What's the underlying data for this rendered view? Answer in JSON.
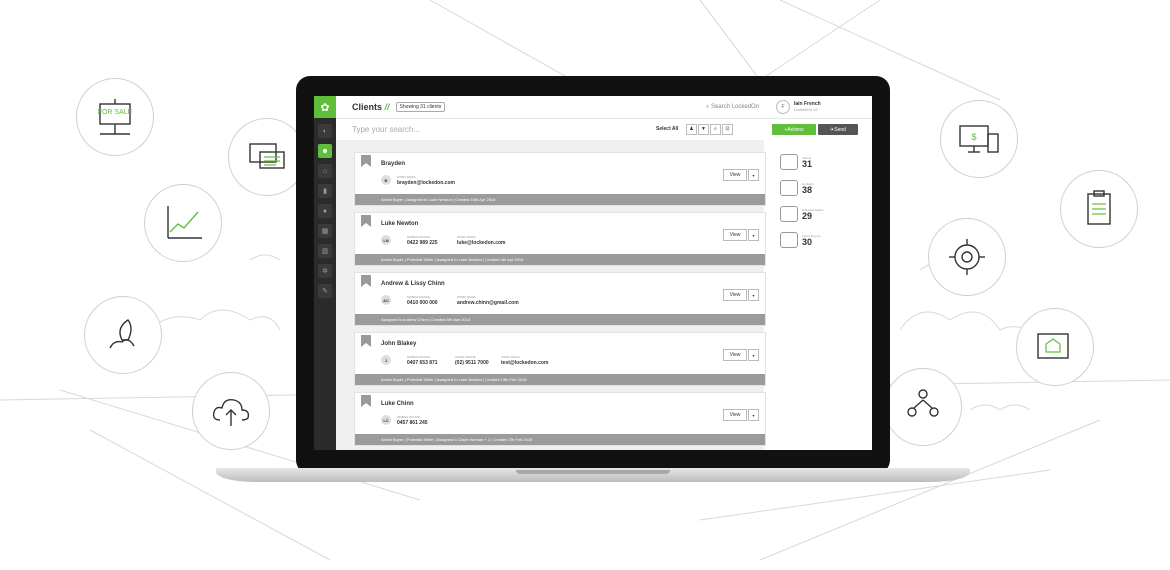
{
  "app": {
    "title": "Clients",
    "title_suffix": "//",
    "count_badge": "Showing 31 clients",
    "search_label": "Search LockedOn",
    "user_initial": "F",
    "user_name": "Iain French",
    "user_company": "LockedOn v2"
  },
  "filter": {
    "placeholder": "Type your search...",
    "select_all": "Select All",
    "actions_label": "Actions",
    "send_label": "Send"
  },
  "labels": {
    "mobile_phone": "MOBILE PHONE",
    "work_email": "WORK EMAIL",
    "home_phone": "HOME PHONE",
    "view": "View"
  },
  "clients": [
    {
      "name": "Brayden",
      "initials": "B",
      "phone": "",
      "home_phone": "",
      "email": "brayden@lockedon.com",
      "footer": "Active Buyer | Assigned to Luke Newton | Created 16th Apr 2018"
    },
    {
      "name": "Luke Newton",
      "initials": "LN",
      "phone": "0422 989 225",
      "home_phone": "",
      "email": "luke@lockedon.com",
      "footer": "Active Buyer | Potential Seller | Assigned to Luke Newton | Created 4th Apr 2018"
    },
    {
      "name": "Andrew & Lissy Chinn",
      "initials": "AC",
      "phone": "0410 000 000",
      "home_phone": "",
      "email": "andrew.chinn@gmail.com",
      "footer": "Assigned to Andrew Chinn | Created 8th Mar 2018"
    },
    {
      "name": "John Blakey",
      "initials": "J",
      "phone": "0407 653 871",
      "home_phone": "(02) 9511 7000",
      "email": "test@lockedon.com",
      "footer": "Active Buyer | Potential Seller | Assigned to Luke Newton | Created 13th Feb 2018"
    },
    {
      "name": "Luke Chinn",
      "initials": "LC",
      "phone": "0457 861 245",
      "home_phone": "",
      "email": "",
      "footer": "Active Buyer | Potential Seller | Assigned to Dave Harman + 1 | Created 7th Feb 2018"
    }
  ],
  "stats": [
    {
      "label": "Clients",
      "value": "31"
    },
    {
      "label": "Contacts",
      "value": "38"
    },
    {
      "label": "Potential Sellers",
      "value": "29"
    },
    {
      "label": "Active Buyers",
      "value": "30"
    }
  ],
  "colors": {
    "accent": "#5fbf3a",
    "rail": "#2b2b2b"
  },
  "badge_initials": "LC",
  "circle_text": {
    "for_sale": "FOR SALE"
  }
}
